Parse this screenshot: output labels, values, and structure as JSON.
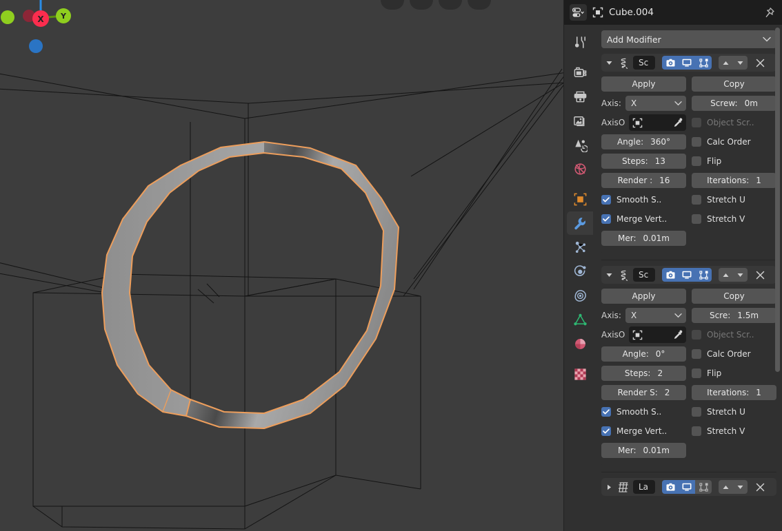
{
  "app": {
    "name": "Blender",
    "theme_bg": "#3b3b3b",
    "accent_blue": "#4772b3",
    "select_orange": "#ed9e5c"
  },
  "viewport": {
    "name": "3d-viewport",
    "background_color": "#3d3d3d",
    "wire_color": "#1a1a1a",
    "selected_outline_color": "#ed9e5c",
    "gizmo": {
      "x_label": "X",
      "y_label": "Y",
      "x_color": "#fc2d4e",
      "y_color": "#8fce1f",
      "z_color": "#2a8ce5",
      "neg_x_color": "#8c2637",
      "neg_y_color": "#5b8f0f"
    }
  },
  "properties": {
    "editor_type_icon": "properties-editor-icon",
    "breadcrumb": {
      "object_icon": "object-data-icon",
      "object_name": "Cube.004"
    },
    "pin_icon": "pin-icon",
    "tabs": [
      {
        "name": "tool",
        "icon": "tool-icon",
        "active": false
      },
      {
        "name": "render",
        "icon": "render-camera-icon",
        "active": false
      },
      {
        "name": "output",
        "icon": "printer-output-icon",
        "active": false
      },
      {
        "name": "view-layer",
        "icon": "images-layer-icon",
        "active": false
      },
      {
        "name": "scene",
        "icon": "scene-cone-icon",
        "active": false
      },
      {
        "name": "world",
        "icon": "world-globe-icon",
        "active": false
      },
      {
        "name": "object",
        "icon": "object-square-icon",
        "active": false
      },
      {
        "name": "modifiers",
        "icon": "wrench-icon",
        "active": true
      },
      {
        "name": "particles",
        "icon": "particles-icon",
        "active": false
      },
      {
        "name": "physics",
        "icon": "physics-orbit-icon",
        "active": false
      },
      {
        "name": "constraints",
        "icon": "constraint-icon",
        "active": false
      },
      {
        "name": "object-data",
        "icon": "mesh-data-icon",
        "active": false
      },
      {
        "name": "material",
        "icon": "material-sphere-icon",
        "active": false
      },
      {
        "name": "texture",
        "icon": "texture-checker-icon",
        "active": false
      }
    ],
    "add_modifier_label": "Add Modifier",
    "modifiers": [
      {
        "id": "screw-1",
        "expanded": true,
        "icon": "screw-modifier-icon",
        "name": "Sc",
        "display_toggles": [
          {
            "name": "render-toggle",
            "icon": "camera-icon",
            "on": true
          },
          {
            "name": "realtime-toggle",
            "icon": "display-icon",
            "on": true
          },
          {
            "name": "edit-mode-toggle",
            "icon": "editmode-icon",
            "on": true
          }
        ],
        "move_up_label": "move-up",
        "move_down_label": "move-down",
        "close_label": "close",
        "apply_label": "Apply",
        "copy_label": "Copy",
        "axis_label": "Axis:",
        "axis_value": "X",
        "axis_object_label": "AxisO",
        "axis_object_value": "",
        "screw_label": "Screw:",
        "screw_value": "0m",
        "object_screw_label": "Object Scr..",
        "object_screw_checked": false,
        "object_screw_disabled": true,
        "angle_label": "Angle:",
        "angle_value": "360°",
        "calc_order_label": "Calc Order",
        "calc_order_checked": false,
        "steps_label": "Steps:",
        "steps_value": "13",
        "flip_label": "Flip",
        "flip_checked": false,
        "render_label": "Render :",
        "render_value": "16",
        "iterations_label": "Iterations:",
        "iterations_value": "1",
        "smooth_label": "Smooth S..",
        "smooth_checked": true,
        "stretch_u_label": "Stretch U",
        "stretch_u_checked": false,
        "merge_label": "Merge Vert..",
        "merge_checked": true,
        "stretch_v_label": "Stretch V",
        "stretch_v_checked": false,
        "merge_dist_label": "Mer:",
        "merge_dist_value": "0.01m"
      },
      {
        "id": "screw-2",
        "expanded": true,
        "icon": "screw-modifier-icon",
        "name": "Sc",
        "display_toggles": [
          {
            "name": "render-toggle",
            "icon": "camera-icon",
            "on": true
          },
          {
            "name": "realtime-toggle",
            "icon": "display-icon",
            "on": true
          },
          {
            "name": "edit-mode-toggle",
            "icon": "editmode-icon",
            "on": true
          }
        ],
        "move_up_label": "move-up",
        "move_down_label": "move-down",
        "close_label": "close",
        "apply_label": "Apply",
        "copy_label": "Copy",
        "axis_label": "Axis:",
        "axis_value": "X",
        "axis_object_label": "AxisO",
        "axis_object_value": "",
        "screw_label": "Scre:",
        "screw_value": "1.5m",
        "object_screw_label": "Object Scr..",
        "object_screw_checked": false,
        "object_screw_disabled": true,
        "angle_label": "Angle:",
        "angle_value": "0°",
        "calc_order_label": "Calc Order",
        "calc_order_checked": false,
        "steps_label": "Steps:",
        "steps_value": "2",
        "flip_label": "Flip",
        "flip_checked": false,
        "render_label": "Render S:",
        "render_value": "2",
        "iterations_label": "Iterations:",
        "iterations_value": "1",
        "smooth_label": "Smooth S..",
        "smooth_checked": true,
        "stretch_u_label": "Stretch U",
        "stretch_u_checked": false,
        "merge_label": "Merge Vert..",
        "merge_checked": true,
        "stretch_v_label": "Stretch V",
        "stretch_v_checked": false,
        "merge_dist_label": "Mer:",
        "merge_dist_value": "0.01m"
      },
      {
        "id": "lattice-3",
        "expanded": false,
        "icon": "lattice-modifier-icon",
        "name": "La",
        "display_toggles": [
          {
            "name": "render-toggle",
            "icon": "camera-icon",
            "on": true
          },
          {
            "name": "realtime-toggle",
            "icon": "display-icon",
            "on": true
          },
          {
            "name": "edit-mode-toggle",
            "icon": "editmode-icon",
            "on": false
          }
        ],
        "move_up_label": "move-up",
        "move_down_label": "move-down",
        "close_label": "close"
      }
    ]
  }
}
